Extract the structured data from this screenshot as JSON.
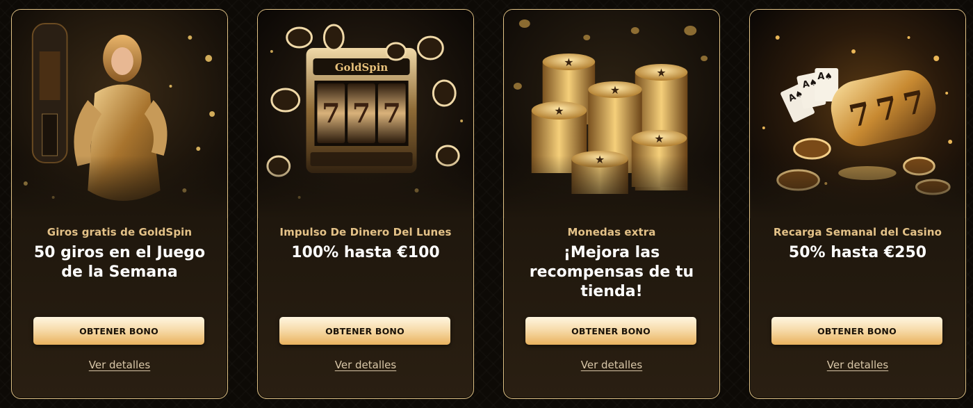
{
  "promos": [
    {
      "subtitle": "Giros gratis de GoldSpin",
      "headline": "50 giros en el Juego de la Semana",
      "cta_label": "OBTENER BONO",
      "details_label": "Ver detalles",
      "image": "woman-gold-dress-image"
    },
    {
      "subtitle": "Impulso De Dinero Del Lunes",
      "headline": "100% hasta €100",
      "cta_label": "OBTENER BONO",
      "details_label": "Ver detalles",
      "image": "slot-machine-image",
      "image_text": "GoldSpin"
    },
    {
      "subtitle": "Monedas extra",
      "headline": "¡Mejora las recompensas de tu tienda!",
      "cta_label": "OBTENER BONO",
      "details_label": "Ver detalles",
      "image": "coin-stacks-image"
    },
    {
      "subtitle": "Recarga Semanal del Casino",
      "headline": "50% hasta €250",
      "cta_label": "OBTENER BONO",
      "details_label": "Ver detalles",
      "image": "cards-and-reels-image"
    }
  ],
  "colors": {
    "accent_gold": "#e4c288",
    "border_gold": "#e3c487",
    "background": "#0d0a06"
  }
}
